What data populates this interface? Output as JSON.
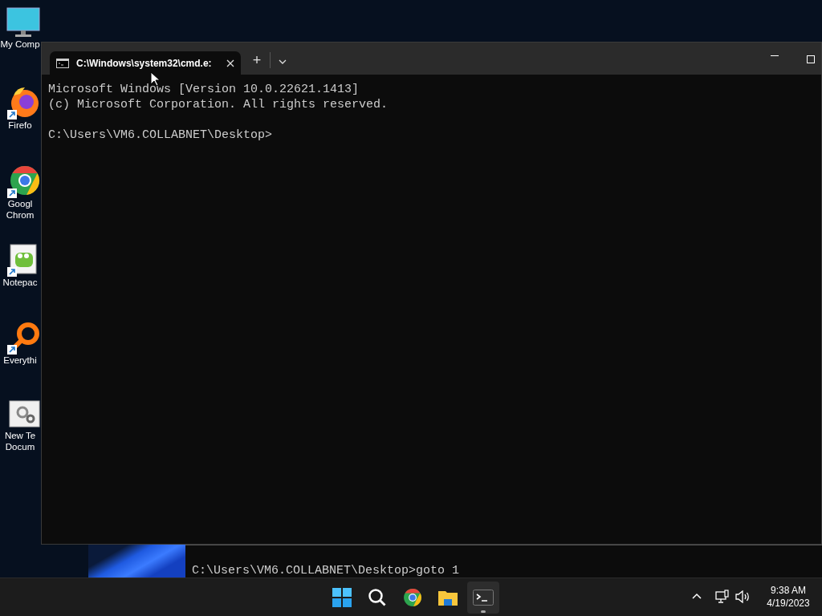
{
  "desktop_icons": [
    {
      "label": "My Comp",
      "shortcut": false
    },
    {
      "label": "Firefo",
      "shortcut": true
    },
    {
      "label": "Googl Chrom",
      "shortcut": true
    },
    {
      "label": "Notepac",
      "shortcut": true
    },
    {
      "label": "Everythi",
      "shortcut": true
    },
    {
      "label": "New Te Docum",
      "shortcut": false
    }
  ],
  "terminal": {
    "tabs": [
      {
        "title": "C:\\Windows\\system32\\cmd.e:",
        "selected": true
      }
    ],
    "new_tab": "+",
    "lines": [
      "Microsoft Windows [Version 10.0.22621.1413]",
      "(c) Microsoft Corporation. All rights reserved."
    ],
    "prompt": "C:\\Users\\VM6.COLLABNET\\Desktop>"
  },
  "background_console": {
    "lines": [
      "C:\\Users\\VM6.COLLABNET\\Desktop>goto 1"
    ]
  },
  "taskbar": {
    "items": [
      {
        "selected": false
      },
      {
        "selected": false
      },
      {
        "selected": false
      },
      {
        "selected": false
      },
      {
        "selected": true
      }
    ],
    "clock": {
      "time": "9:38 AM",
      "date": "4/19/2023"
    }
  }
}
